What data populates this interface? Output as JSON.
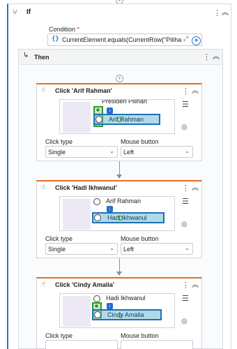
{
  "if_block": {
    "icon": "if-branch-icon",
    "title": "If",
    "condition_label": "Condition",
    "condition_required": "*",
    "condition_value": "CurrentElement.equals(CurrentRow(\"Piliha"
  },
  "then_block": {
    "icon": "then-arrow-icon",
    "title": "Then"
  },
  "activities": [
    {
      "title": "Click 'Arif Rahman'",
      "screenshot_context_text": "Presiden Pilihan",
      "screenshot_target_text": "Arif Rahman",
      "click_type_label": "Click type",
      "click_type_value": "Single",
      "mouse_button_label": "Mouse button",
      "mouse_button_value": "Left"
    },
    {
      "title": "Click 'Hadi Ikhwanul'",
      "screenshot_context_text": "Arif Rahman",
      "screenshot_target_text": "Hadi Ikhwanul",
      "click_type_label": "Click type",
      "click_type_value": "Single",
      "mouse_button_label": "Mouse button",
      "mouse_button_value": "Left"
    },
    {
      "title": "Click 'Cindy Amalia'",
      "screenshot_context_text": "Hadi Ikhwanul",
      "screenshot_target_text": "Cindy Amalia",
      "click_type_label": "Click type",
      "click_type_value": "",
      "mouse_button_label": "Mouse button",
      "mouse_button_value": ""
    }
  ],
  "colors": {
    "accent_blue": "#2a6fc9",
    "activity_top_border": "#e06f24",
    "highlight_blue": "#1f6fb5",
    "anchor_green": "#2d9a2d"
  }
}
